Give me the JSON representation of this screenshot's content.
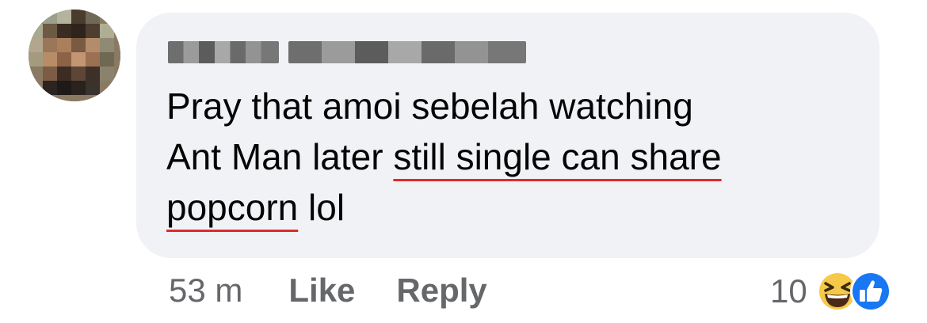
{
  "comment": {
    "author_avatar_icon": "pixelated-avatar",
    "author_name_blurred": true,
    "text_lines": [
      "Pray that amoi sebelah watching",
      "Ant Man later ",
      "still single can share",
      "popcorn",
      " lol"
    ],
    "underline_color": "#e02b2b"
  },
  "footer": {
    "time": "53 m",
    "like_label": "Like",
    "reply_label": "Reply",
    "reaction_count": "10",
    "reaction_icons": [
      "laugh-emoji-icon",
      "like-thumb-icon"
    ]
  },
  "colors": {
    "bubble_bg": "#f0f2f5",
    "meta_text": "#65676b",
    "like_blue": "#1877f2",
    "laugh_yellow": "#f7c948"
  }
}
